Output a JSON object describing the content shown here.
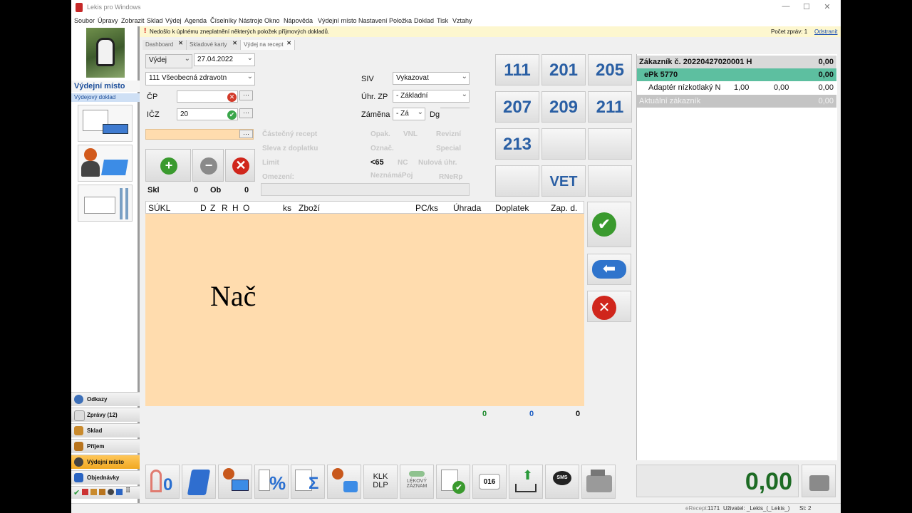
{
  "window": {
    "title": "Lekis pro Windows"
  },
  "menu": [
    "Soubor",
    "Úpravy",
    "Zobrazit",
    "Sklad",
    "Výdej",
    "Agenda",
    "Číselníky",
    "Nástroje",
    "Okno",
    "Nápověda",
    "Výdejní místo",
    "Nastavení",
    "Položka",
    "Doklad",
    "Tisk",
    "Vztahy"
  ],
  "notice": {
    "text": "Nedošlo k úplnému zneplatnění některých položek příjmových dokladů.",
    "count_label": "Počet zpráv: 1",
    "remove": "Odstranit"
  },
  "tabs": [
    "Dashboard",
    "Skladové karty",
    "Výdej na recept"
  ],
  "left": {
    "section_title": "Výdejní místo",
    "section_sub": "Výdejový doklad",
    "nav": [
      "Odkazy",
      "Zprávy (12)",
      "Sklad",
      "Příjem",
      "Výdejní místo",
      "Objednávky"
    ]
  },
  "form": {
    "type": "Výdej",
    "date": "27.04.2022",
    "insurer": "111 Všeobecná zdravotn",
    "cp_label": "ČP",
    "icz_label": "IČZ",
    "icz_value": "20",
    "siv_label": "SIV",
    "siv_value": "Vykazovat",
    "uhr_label": "Úhr. ZP",
    "uhr_value": "- Základní",
    "zamena_label": "Záměna",
    "zamena_value": "- Zá",
    "dg_label": "Dg",
    "flags_col1": [
      "Částečný recept",
      "Sleva z doplatku",
      "Limit",
      "Omezení:"
    ],
    "flags_col2": [
      "Opak.",
      "Označ.",
      "<65",
      "NeznámáPoj"
    ],
    "flags_col2b": [
      "VNL",
      "",
      "NC",
      ""
    ],
    "flags_col3": [
      "Revizní",
      "Special",
      "Nulová úhr.",
      "RNeRp"
    ],
    "skl_label": "Skl",
    "skl_value": "0",
    "ob_label": "Ob",
    "ob_value": "0"
  },
  "codes": [
    "111",
    "201",
    "205",
    "207",
    "209",
    "211",
    "213",
    "",
    "",
    "",
    "VET",
    ""
  ],
  "grid": {
    "headers": [
      "SÚKL",
      "D",
      "Z",
      "R",
      "H",
      "O",
      "ks",
      "Zboží",
      "PC/ks",
      "Úhrada",
      "Doplatek",
      "Zap. d."
    ],
    "overlay_text": "Nač",
    "totals": [
      "0",
      "0",
      "0"
    ]
  },
  "customer": {
    "title": "Zákazník č. 20220427020001 H",
    "title_value": "0,00",
    "epk": "ePk 5770",
    "epk_value": "0,00",
    "item_name": "Adaptér nízkotlaký N",
    "item_qty": "1,00",
    "item_v1": "0,00",
    "item_v2": "0,00",
    "current": "Aktuální zákazník",
    "current_value": "0,00"
  },
  "total": "0,00",
  "toolbar": {
    "klk": "KLK",
    "dlp": "DLP",
    "lekovy": "LÉKOVÝ",
    "zaznam": "ZÁZNAM",
    "code016": "016",
    "sms": "SMS"
  },
  "status": {
    "erecept": "eRecept:",
    "erecept_val": "1171",
    "user": "Uživatel: _Lekis_(_Lekis_)",
    "st": "St: 2"
  }
}
